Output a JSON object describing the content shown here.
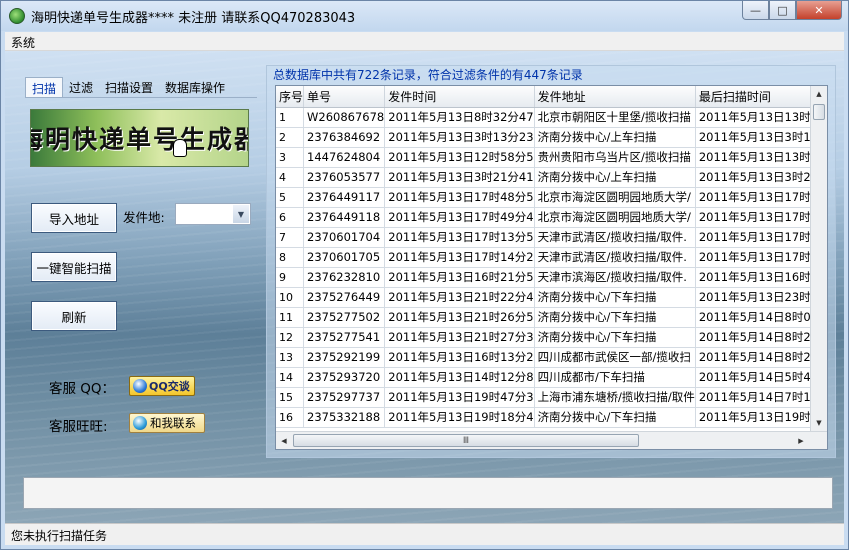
{
  "window": {
    "title": "海明快递单号生成器****  未注册 请联系QQ470283043",
    "minimize_label": "—",
    "maximize_label": "□",
    "close_label": "✕"
  },
  "menu": {
    "system": "系统"
  },
  "tabs": [
    {
      "label": "扫描",
      "active": true
    },
    {
      "label": "过滤"
    },
    {
      "label": "扫描设置"
    },
    {
      "label": "数据库操作"
    }
  ],
  "banner": {
    "text": "海明快递单号生成器"
  },
  "controls": {
    "import_button": "导入地址",
    "sender_label": "发件地:",
    "sender_value": "",
    "smart_scan_button": "一键智能扫描",
    "refresh_button": "刷新"
  },
  "support": {
    "qq_label": "客服 QQ：",
    "qq_button": "QQ交谈",
    "wangwang_label": "客服旺旺:",
    "wangwang_button": "和我联系"
  },
  "summary": "总数据库中共有722条记录，符合过滤条件的有447条记录",
  "table": {
    "columns": [
      "序号",
      "单号",
      "发件时间",
      "发件地址",
      "最后扫描时间"
    ],
    "rows": [
      [
        "1",
        "W260867678",
        "2011年5月13日8时32分47",
        "北京市朝阳区十里堡/揽收扫描",
        "2011年5月13日13时30分"
      ],
      [
        "2",
        "2376384692",
        "2011年5月13日3时13分23",
        "济南分拨中心/上车扫描",
        "2011年5月13日3时13分2"
      ],
      [
        "3",
        "1447624804",
        "2011年5月13日12时58分5",
        "贵州贵阳市乌当片区/揽收扫描",
        "2011年5月13日13时4分3"
      ],
      [
        "4",
        "2376053577",
        "2011年5月13日3时21分41",
        "济南分拨中心/上车扫描",
        "2011年5月13日3时21分4"
      ],
      [
        "5",
        "2376449117",
        "2011年5月13日17时48分5",
        "北京市海淀区圆明园地质大学/",
        "2011年5月13日17时58分"
      ],
      [
        "6",
        "2376449118",
        "2011年5月13日17时49分4",
        "北京市海淀区圆明园地质大学/",
        "2011年5月13日17时58分"
      ],
      [
        "7",
        "2370601704",
        "2011年5月13日17时13分5",
        "天津市武清区/揽收扫描/取件.",
        "2011年5月13日17时16分"
      ],
      [
        "8",
        "2370601705",
        "2011年5月13日17时14分2",
        "天津市武清区/揽收扫描/取件.",
        "2011年5月13日17时16分"
      ],
      [
        "9",
        "2376232810",
        "2011年5月13日16时21分5",
        "天津市滨海区/揽收扫描/取件.",
        "2011年5月13日16时21分"
      ],
      [
        "10",
        "2375276449",
        "2011年5月13日21时22分4",
        "济南分拨中心/下车扫描",
        "2011年5月13日23时24分"
      ],
      [
        "11",
        "2375277502",
        "2011年5月13日21时26分5",
        "济南分拨中心/下车扫描",
        "2011年5月14日8时0分41"
      ],
      [
        "12",
        "2375277541",
        "2011年5月13日21时27分3",
        "济南分拨中心/下车扫描",
        "2011年5月14日8时23分5"
      ],
      [
        "13",
        "2375292199",
        "2011年5月13日16时13分2",
        "四川成都市武侯区一部/揽收扫",
        "2011年5月14日8时24分1"
      ],
      [
        "14",
        "2375293720",
        "2011年5月13日14时12分8",
        "四川成都市/下车扫描",
        "2011年5月14日5时49分4"
      ],
      [
        "15",
        "2375297737",
        "2011年5月13日19时47分3",
        "上海市浦东塘桥/揽收扫描/取件",
        "2011年5月14日7时12分5"
      ],
      [
        "16",
        "2375332188",
        "2011年5月13日19时18分4",
        "济南分拨中心/下车扫描",
        "2011年5月13日19时31分"
      ]
    ]
  },
  "scrollbar": {
    "grip": "Ⅲ"
  },
  "status": "您未执行扫描任务",
  "colors": {
    "accent": "#0033aa",
    "window_bg": "#c9dcf1",
    "close_red": "#c4412b"
  }
}
